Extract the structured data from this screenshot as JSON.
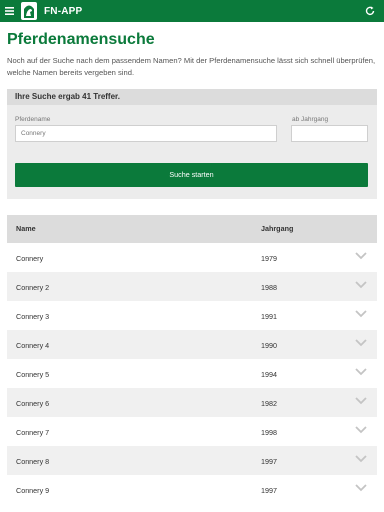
{
  "header": {
    "app_title": "FN-APP"
  },
  "page": {
    "title": "Pferdenamensuche",
    "intro": "Noch auf der Suche nach dem passendem Namen? Mit der Pferdenamensuche lässt sich schnell überprüfen, welche Namen bereits vergeben sind."
  },
  "search": {
    "result_text": "Ihre Suche ergab 41 Treffer.",
    "name_label": "Pferdename",
    "name_value": "Connery",
    "year_label": "ab Jahrgang",
    "year_value": "",
    "submit_label": "Suche starten"
  },
  "table": {
    "headers": {
      "name": "Name",
      "year": "Jahrgang"
    },
    "rows": [
      {
        "name": "Connery",
        "year": "1979"
      },
      {
        "name": "Connery 2",
        "year": "1988"
      },
      {
        "name": "Connery 3",
        "year": "1991"
      },
      {
        "name": "Connery 4",
        "year": "1990"
      },
      {
        "name": "Connery 5",
        "year": "1994"
      },
      {
        "name": "Connery 6",
        "year": "1982"
      },
      {
        "name": "Connery 7",
        "year": "1998"
      },
      {
        "name": "Connery 8",
        "year": "1997"
      },
      {
        "name": "Connery 9",
        "year": "1997"
      }
    ]
  },
  "icons": {
    "menu": "menu-icon",
    "logo": "horse-logo-icon",
    "refresh": "refresh-icon",
    "row_expand": "chevron-down-icon"
  },
  "colors": {
    "brand": "#0b7a3b",
    "header_row": "#dcdcdc",
    "alt_row": "#f0f0f0"
  }
}
